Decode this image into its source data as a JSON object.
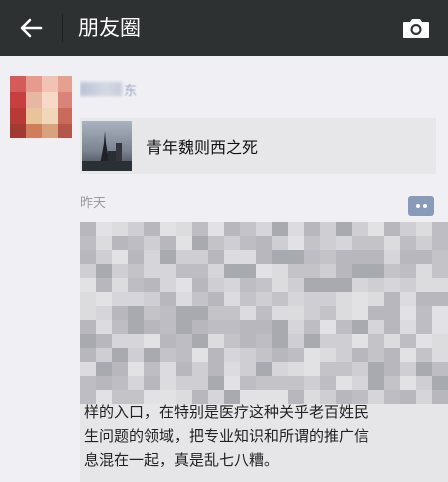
{
  "header": {
    "title": "朋友圈",
    "back_icon": "arrow-left-icon",
    "camera_icon": "camera-icon"
  },
  "post": {
    "author_tail": "东",
    "share_card": {
      "title": "青年魏则西之死"
    },
    "time": "昨天",
    "comment_icon": "comment-dots-icon",
    "comment_visible": {
      "line1": "样的入口，在特别是医疗这种关乎老百姓民",
      "line2": "生问题的领域，把专业知识和所谓的推广信",
      "line3": "息混在一起，真是乱七八糟。"
    }
  },
  "colors": {
    "topbar": "#2e3132",
    "background": "#efeff4",
    "card": "#e7e7ea",
    "link": "#7a8fb5",
    "comment_btn": "#8a9bb9"
  }
}
